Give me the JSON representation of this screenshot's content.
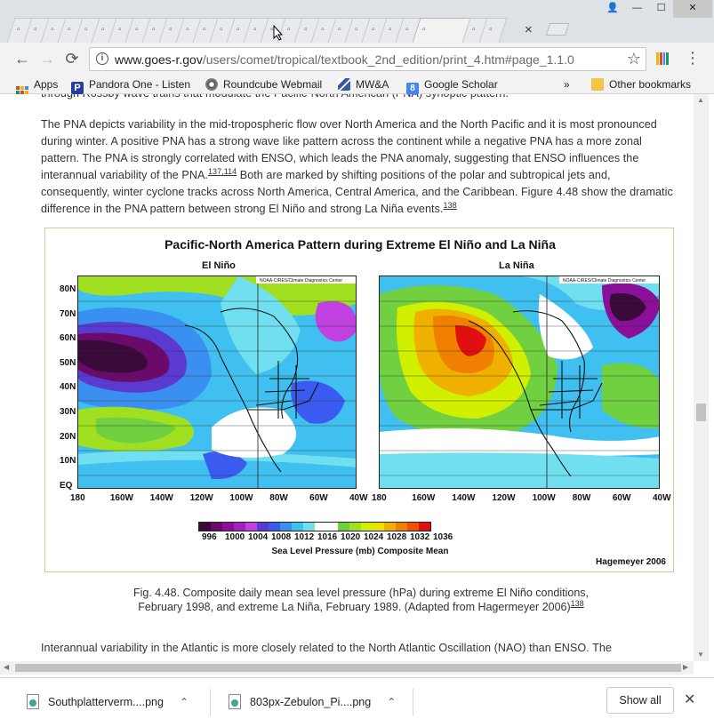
{
  "browser": {
    "address_url_host": "www.goes-r.gov",
    "address_url_path": "/users/comet/tropical/textbook_2nd_edition/print_4.htm#page_1.1.0",
    "window_controls": {
      "user": "👤",
      "minimize": "—",
      "maximize": "☐",
      "close": "✕"
    },
    "tab_close": "×",
    "nav": {
      "back": "←",
      "forward": "→",
      "reload": "⟳"
    },
    "star": "☆",
    "menu": "⋮"
  },
  "bookmarks": {
    "items": [
      {
        "label": "Apps",
        "icon": "apps-grid-icon"
      },
      {
        "label": "Pandora One - Listen",
        "icon": "pandora-icon"
      },
      {
        "label": "Roundcube Webmail",
        "icon": "roundcube-icon"
      },
      {
        "label": "MW&A",
        "icon": "mwa-icon"
      },
      {
        "label": "Google Scholar",
        "icon": "google-scholar-icon"
      }
    ],
    "overflow": "»",
    "other": "Other bookmarks"
  },
  "article": {
    "cut_line": "through Rossby wave trains that modulate the Pacific-North American (PNA)        synoptic pattern.",
    "para1_a": "The PNA depicts variability in the mid-tropospheric flow over North America and the North Pacific and it is most pronounced during winter. A positive PNA has a strong wave like pattern across the continent while a negative PNA has a more zonal pattern. The PNA is strongly correlated with ENSO, which leads the PNA anomaly, suggesting that ENSO influences the interannual variability of the PNA.",
    "ref1": "137",
    "ref_sep": ",",
    "ref2": "114",
    "para1_b": " Both are marked by shifting positions of the polar and subtropical jets and, consequently, winter cyclone tracks across North America, Central America, and the Caribbean. Figure 4.48 show the dramatic difference in the PNA pattern between strong El Niño and strong La Niña events.",
    "ref3": "138",
    "para2": "Interannual variability in the Atlantic is more closely related to the North Atlantic Oscillation (NAO) than ENSO. The"
  },
  "figure": {
    "title": "Pacific-North America Pattern during Extreme El Niño and La Niña",
    "left_label": "El Niño",
    "right_label": "La Niña",
    "map_credit": "NOAA-CIRES/Climate Diagnostics Center",
    "lat_labels": [
      "80N",
      "70N",
      "60N",
      "50N",
      "40N",
      "30N",
      "20N",
      "10N",
      "EQ"
    ],
    "lon_labels_left": [
      "180",
      "160W",
      "140W",
      "120W",
      "100W",
      "80W",
      "60W",
      "40W"
    ],
    "lon_labels_right": [
      "180",
      "160W",
      "140W",
      "120W",
      "100W",
      "80W",
      "60W",
      "40W"
    ],
    "colorbar_labels": [
      "996",
      "1000",
      "1004",
      "1008",
      "1012",
      "1016",
      "1020",
      "1024",
      "1028",
      "1032",
      "1036"
    ],
    "colorbar_colors": [
      "#3a0a3a",
      "#6a0a6a",
      "#8a109a",
      "#a020c0",
      "#c040e0",
      "#5a3ad0",
      "#3a5af0",
      "#3a90f0",
      "#40c0f0",
      "#70e0f0",
      "#ffffff",
      "#ffffff",
      "#70d040",
      "#a0e020",
      "#d0f000",
      "#f0e000",
      "#f0b000",
      "#f08000",
      "#f05000",
      "#e01010"
    ],
    "axis_title": "Sea Level Pressure (mb) Composite Mean",
    "credit": "Hagemeyer 2006"
  },
  "caption": {
    "text": "Fig. 4.48. Composite daily mean sea level pressure (hPa) during extreme El Niño conditions, February 1998, and extreme La Niña, February 1989. (Adapted from Hagermeyer 2006)",
    "ref": "138"
  },
  "downloads": {
    "items": [
      {
        "name": "Southplatterverm....png"
      },
      {
        "name": "803px-Zebulon_Pi....png"
      }
    ],
    "chevron": "⌃",
    "show_all": "Show all",
    "close": "✕"
  }
}
